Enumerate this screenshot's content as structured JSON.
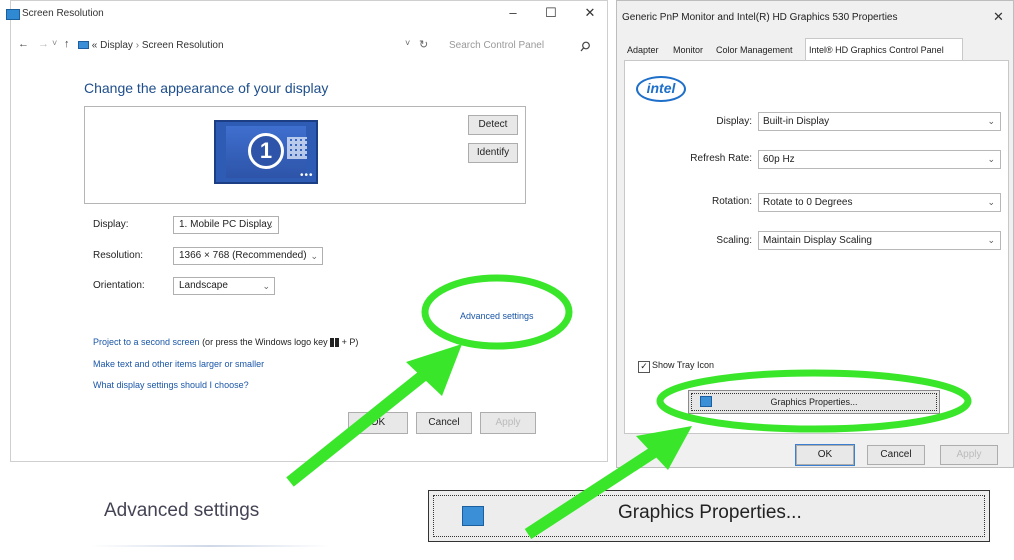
{
  "screen_resolution": {
    "window_title": "Screen Resolution",
    "controls": {
      "minimize": "–",
      "maximize": "☐",
      "close": "✕"
    },
    "nav": {
      "back": "←",
      "forward": "→",
      "dropdown": "˅",
      "up": "↑",
      "refresh": "↻"
    },
    "address": {
      "sep1": "«",
      "crumb1": "Display",
      "sep2": "›",
      "crumb2": "Screen Resolution"
    },
    "search": {
      "placeholder": "Search Control Panel",
      "icon": "search-icon"
    },
    "heading": "Change the appearance of your display",
    "monitor_number": "1",
    "detect_label": "Detect",
    "identify_label": "Identify",
    "display_label": "Display:",
    "display_value": "1. Mobile PC Display",
    "resolution_label": "Resolution:",
    "resolution_value": "1366 × 768 (Recommended)",
    "orientation_label": "Orientation:",
    "orientation_value": "Landscape",
    "advanced_settings": "Advanced settings",
    "project_link": "Project to a second screen",
    "project_text": " (or press the Windows logo key",
    "project_key": " + P)",
    "text_size_link": "Make text and other items larger or smaller",
    "help_link": "What display settings should I choose?",
    "ok_label": "OK",
    "cancel_label": "Cancel",
    "apply_label": "Apply"
  },
  "properties_dialog": {
    "title": "Generic PnP Monitor and Intel(R) HD Graphics 530 Properties",
    "close": "✕",
    "tabs": [
      {
        "label": "Adapter"
      },
      {
        "label": "Monitor"
      },
      {
        "label": "Color Management"
      },
      {
        "label": "Intel® HD Graphics Control Panel"
      }
    ],
    "logo_text": "intel",
    "display_label": "Display:",
    "display_value": "Built-in Display",
    "refresh_label": "Refresh Rate:",
    "refresh_value": "60p Hz",
    "rotation_label": "Rotation:",
    "rotation_value": "Rotate to 0 Degrees",
    "scaling_label": "Scaling:",
    "scaling_value": "Maintain Display Scaling",
    "show_tray_label": "Show Tray Icon",
    "show_tray_checked": true,
    "graphics_properties_label": "Graphics Properties...",
    "ok_label": "OK",
    "cancel_label": "Cancel",
    "apply_label": "Apply"
  },
  "callouts": {
    "advanced_settings_zoom": "Advanced settings",
    "graphics_properties_zoom": "Graphics Properties...",
    "highlight_color": "#39e62a"
  }
}
